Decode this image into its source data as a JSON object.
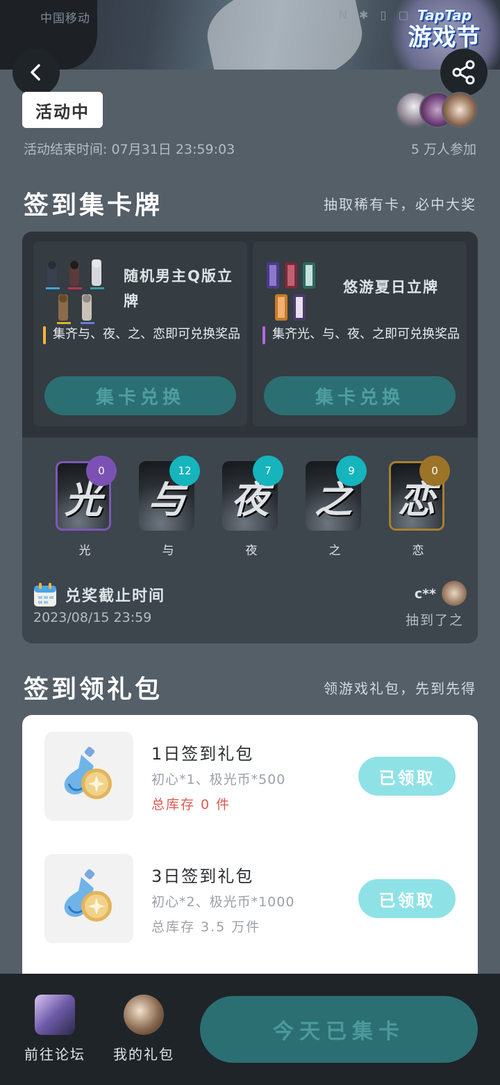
{
  "status_bar": {
    "carrier": "中国移动",
    "icons": "N ✱ ▯ ▢ 100"
  },
  "header": {
    "banner_logo_top": "TapTap",
    "banner_logo_bottom": "游戏节",
    "back_icon": "chevron-left-icon",
    "share_icon": "share-icon"
  },
  "activity": {
    "status_chip": "活动中",
    "end_time": "活动结束时间: 07月31日 23:59:03",
    "participants": "5 万人参加"
  },
  "checkin_cards": {
    "title": "签到集卡牌",
    "subtitle": "抽取稀有卡，必中大奖",
    "prizes": [
      {
        "name": "随机男主Q版立牌",
        "description": "集齐与、夜、之、恋即可兑换奖品",
        "button": "集卡兑换",
        "accent": "#f2b63a"
      },
      {
        "name": "悠游夏日立牌",
        "description": "集齐光、与、夜、之即可兑换奖品",
        "button": "集卡兑换",
        "accent": "#b06be0"
      }
    ],
    "cards": [
      {
        "char": "光",
        "label": "光",
        "count": "0",
        "color": "#7b52b3"
      },
      {
        "char": "与",
        "label": "与",
        "count": "12",
        "color": "#16b4bc"
      },
      {
        "char": "夜",
        "label": "夜",
        "count": "7",
        "color": "#16b4bc"
      },
      {
        "char": "之",
        "label": "之",
        "count": "9",
        "color": "#16b4bc"
      },
      {
        "char": "恋",
        "label": "恋",
        "count": "0",
        "color": "#9c7428"
      }
    ],
    "deadline_label": "兑奖截止时间",
    "deadline_date": "2023/08/15 23:59",
    "winner_name": "c**",
    "winner_text": "抽到了之"
  },
  "checkin_gifts": {
    "title": "签到领礼包",
    "subtitle": "领游戏礼包，先到先得",
    "gifts": [
      {
        "title": "1日签到礼包",
        "items": "初心*1、极光币*500",
        "stock": "总库存 0 件",
        "button": "已领取"
      },
      {
        "title": "3日签到礼包",
        "items": "初心*2、极光币*1000",
        "stock": "总库存 3.5 万件",
        "button": "已领取"
      }
    ]
  },
  "bottom_bar": {
    "forum_label": "前往论坛",
    "gifts_label": "我的礼包",
    "cta": "今天已集卡"
  }
}
